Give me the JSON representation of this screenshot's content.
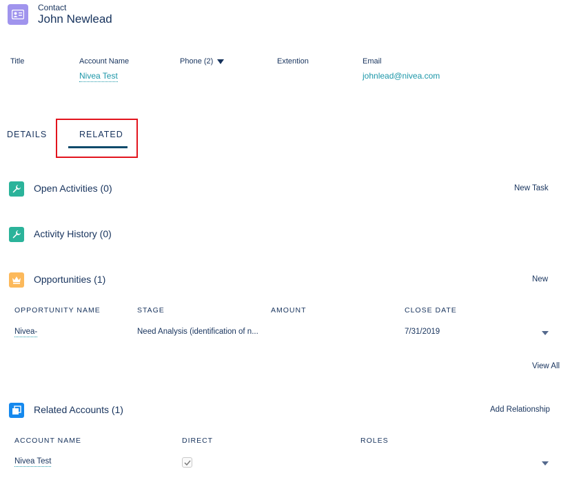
{
  "header": {
    "object_label": "Contact",
    "record_name": "John Newlead",
    "icon": "contact-card-icon",
    "icon_color": "#a094ed"
  },
  "highlights": {
    "title_label": "Title",
    "account_label": "Account Name",
    "account_value": "Nivea Test",
    "phone_label": "Phone (2)",
    "extension_label": "Extention",
    "email_label": "Email",
    "email_value": "johnlead@nivea.com"
  },
  "tabs": {
    "details": "DETAILS",
    "related": "RELATED",
    "active": "related",
    "active_color": "#0b4a6b",
    "highlight_box_color": "#e2131c"
  },
  "sections": {
    "open_activities": {
      "title": "Open Activities (0)",
      "action": "New Task",
      "icon": "wrench-icon",
      "color": "#2bb39a"
    },
    "activity_history": {
      "title": "Activity History (0)",
      "icon": "wrench-icon",
      "color": "#2bb39a"
    },
    "opportunities": {
      "title": "Opportunities (1)",
      "action": "New",
      "icon": "crown-icon",
      "color": "#fcb95b",
      "columns": [
        "OPPORTUNITY NAME",
        "STAGE",
        "AMOUNT",
        "CLOSE DATE"
      ],
      "rows": [
        {
          "name": "Nivea-",
          "stage": "Need Analysis (identification of n...",
          "amount": "",
          "close_date": "7/31/2019"
        }
      ],
      "view_all": "View All"
    },
    "related_accounts": {
      "title": "Related Accounts (1)",
      "action": "Add Relationship",
      "icon": "related-accounts-icon",
      "color": "#1589ee",
      "columns": [
        "ACCOUNT NAME",
        "DIRECT",
        "ROLES"
      ],
      "rows": [
        {
          "name": "Nivea Test",
          "direct": true,
          "roles": ""
        }
      ]
    }
  }
}
